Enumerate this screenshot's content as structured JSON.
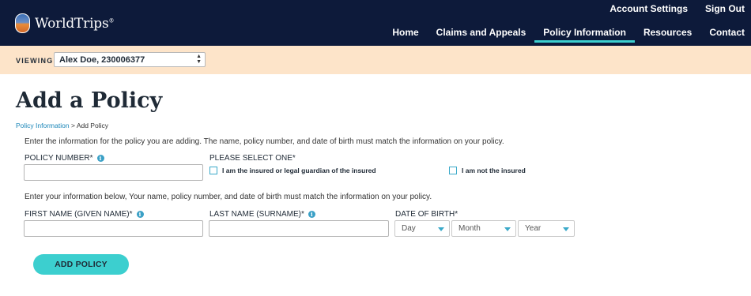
{
  "brand": {
    "name": "WorldTrips",
    "trademark": "®"
  },
  "top_links": [
    "Account Settings",
    "Sign Out"
  ],
  "nav": {
    "items": [
      "Home",
      "Claims and Appeals",
      "Policy Information",
      "Resources",
      "Contact"
    ],
    "active": "Policy Information"
  },
  "viewing": {
    "label": "VIEWING:",
    "selected": "Alex Doe, 230006377"
  },
  "page": {
    "title": "Add a Policy",
    "breadcrumb": {
      "link": "Policy Information",
      "separator": ">",
      "current": "Add Policy"
    },
    "intro": "Enter the information for the policy you are adding. The name, policy number, and date of birth must match the information on your policy.",
    "intro2": "Enter your information below, Your name, policy number, and date of birth must match the information on your policy."
  },
  "form": {
    "policy_number_label": "POLICY NUMBER*",
    "select_one_label": "PLEASE SELECT ONE*",
    "option_insured": "I am the insured or legal guardian of the insured",
    "option_not_insured": "I am not the insured",
    "first_name_label": "FIRST NAME (GIVEN NAME)*",
    "last_name_label": "LAST NAME (SURNAME)*",
    "dob_label": "DATE OF BIRTH*",
    "dob_day": "Day",
    "dob_month": "Month",
    "dob_year": "Year",
    "info_glyph": "i",
    "submit_label": "ADD POLICY"
  },
  "colors": {
    "header_bg": "#0d1a3a",
    "accent": "#3ccfcf",
    "viewing_bg": "#fde4c9",
    "link": "#1a86b8"
  }
}
